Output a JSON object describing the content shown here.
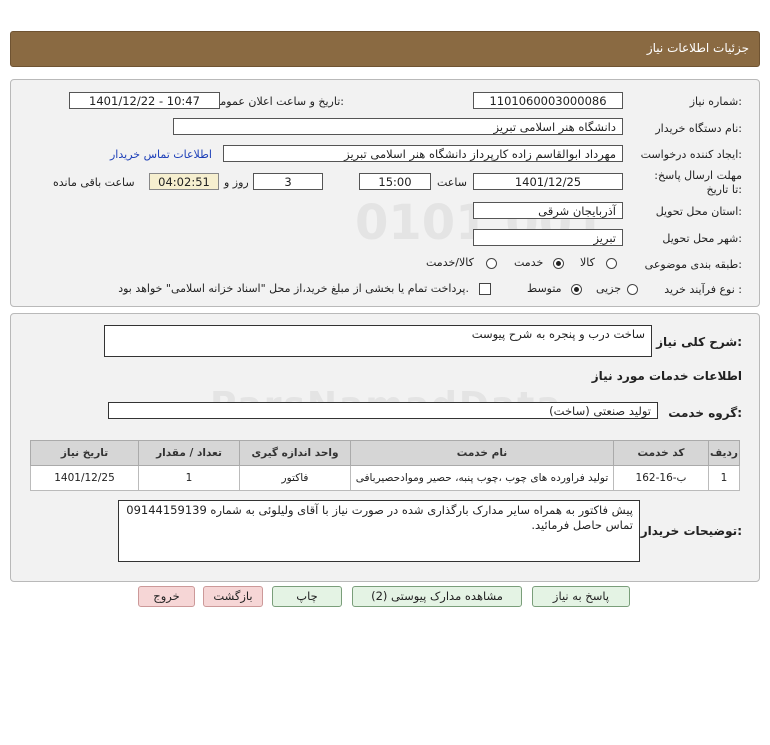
{
  "header": {
    "title": "جزئیات اطلاعات نیاز"
  },
  "form": {
    "need_number_label": "شماره نیاز:",
    "need_number": "1101060003000086",
    "announce_label": "تاریخ و ساعت اعلان عمومی:",
    "announce_value": "1401/12/22 - 10:47",
    "buyer_org_label": "نام دستگاه خریدار:",
    "buyer_org": "دانشگاه هنر اسلامی تبریز",
    "requester_label": "ایجاد کننده درخواست:",
    "requester": "مهرداد ابوالقاسم زاده کارپرداز دانشگاه هنر اسلامی تبریز",
    "contact_link": "اطلاعات تماس خریدار",
    "deadline_label": "مهلت ارسال پاسخ: تا تاریخ:",
    "deadline_date": "1401/12/25",
    "time_label": "ساعت",
    "deadline_time": "15:00",
    "days_value": "3",
    "days_label": "روز و",
    "remaining_value": "04:02:51",
    "remaining_label": "ساعت باقی مانده",
    "province_label": "استان محل تحویل:",
    "province": "آذربایجان شرقی",
    "city_label": "شهر محل تحویل:",
    "city": "تبریز",
    "category_label": "طبقه بندی موضوعی:",
    "category_options": [
      "کالا",
      "خدمت",
      "کالا/خدمت"
    ],
    "category_selected": "خدمت",
    "process_label": "نوع فرآیند خرید :",
    "process_options": [
      "جزیی",
      "متوسط"
    ],
    "process_selected": "متوسط",
    "payment_text": "پرداخت تمام یا بخشی از مبلغ خرید،از محل \"اسناد خزانه اسلامی\" خواهد بود."
  },
  "details": {
    "summary_label": "شرح کلی نیاز:",
    "summary": "ساخت درب و پنجره به شرح پیوست",
    "services_title": "اطلاعات خدمات مورد نیاز",
    "service_group_label": "گروه خدمت:",
    "service_group": "تولید صنعتی (ساخت)",
    "table": {
      "headers": [
        "ردیف",
        "کد خدمت",
        "نام خدمت",
        "واحد اندازه گیری",
        "تعداد / مقدار",
        "تاریخ نیاز"
      ],
      "rows": [
        [
          "1",
          "ب-16-162",
          "تولید فراورده های چوب ،چوب پنبه، حصیر وموادحصیربافی",
          "فاکتور",
          "1",
          "1401/12/25"
        ]
      ]
    },
    "buyer_notes_label": "توضیحات خریدار:",
    "buyer_notes": "پیش فاکتور به همراه سایر مدارک بارگذاری شده در صورت نیاز با آقای ولیلوئی به شماره 09144159139 تماس حاصل فرمائید."
  },
  "buttons": {
    "reply": "پاسخ به نیاز",
    "attachments": "مشاهده مدارک پیوستی (2)",
    "print": "چاپ",
    "back": "بازگشت",
    "exit": "خروج"
  }
}
